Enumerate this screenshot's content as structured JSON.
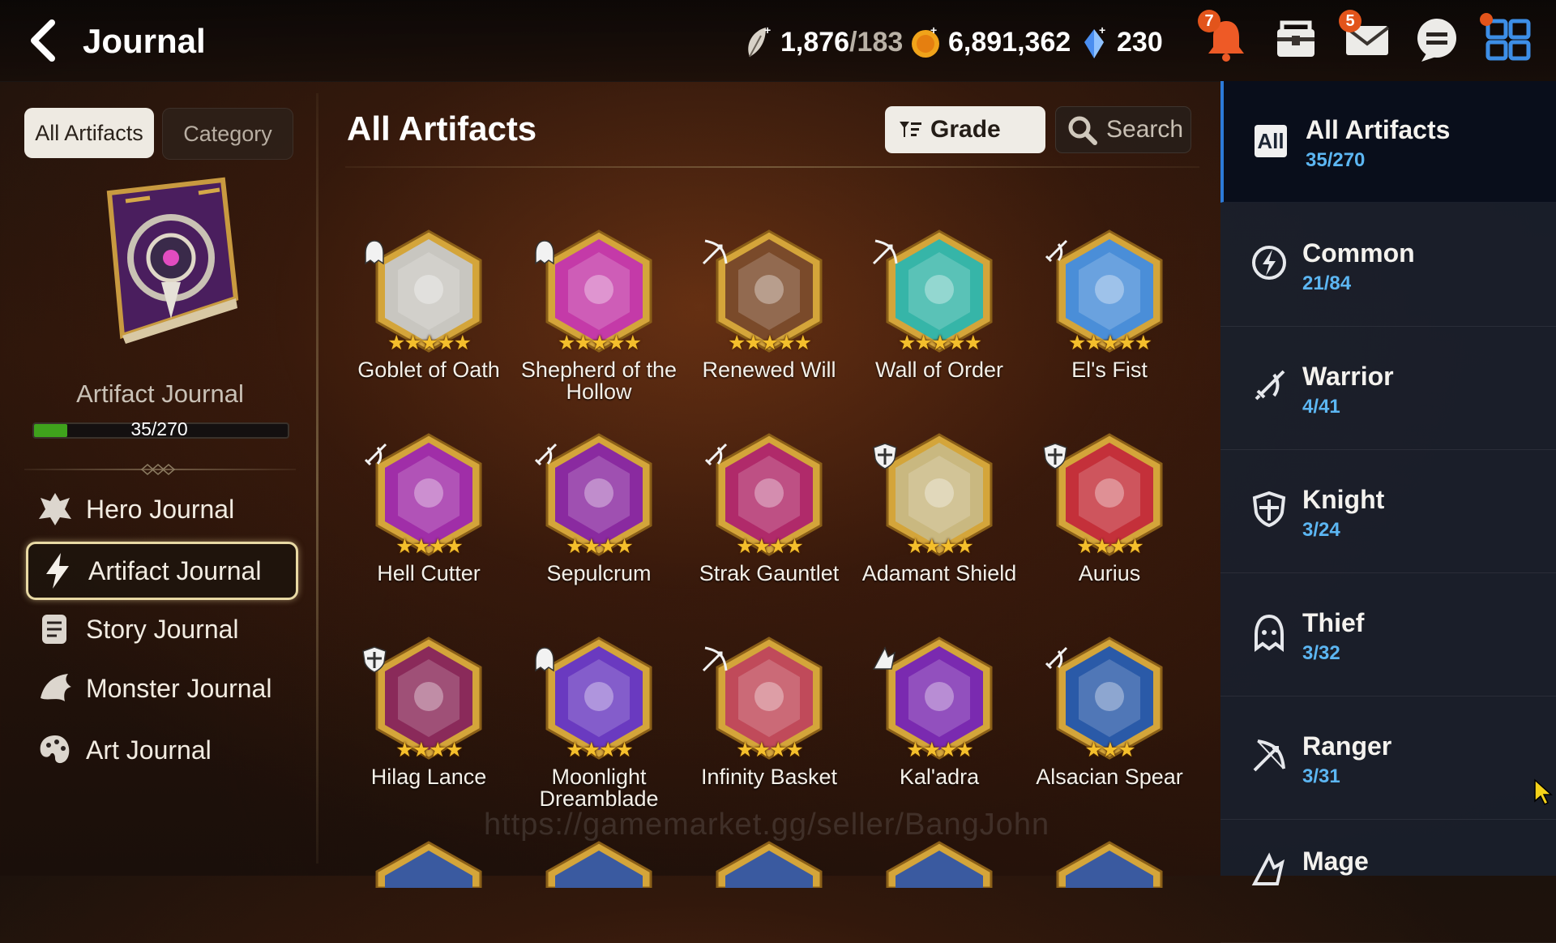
{
  "header": {
    "title": "Journal",
    "resources": [
      {
        "name": "stamina",
        "icon": "leaf-icon",
        "value": "1,876",
        "max": "/183"
      },
      {
        "name": "gold",
        "icon": "gold-coin-icon",
        "value": "6,891,362",
        "max": ""
      },
      {
        "name": "skystone",
        "icon": "crystal-icon",
        "value": "230",
        "max": ""
      }
    ],
    "notifications_badge": "7",
    "mail_badge": "5"
  },
  "left": {
    "tabs": {
      "all": "All Artifacts",
      "category": "Category"
    },
    "journal_label": "Artifact Journal",
    "progress_text": "35/270",
    "progress_fraction": 0.13,
    "nav": [
      {
        "label": "Hero Journal",
        "icon": "hero-icon"
      },
      {
        "label": "Artifact Journal",
        "icon": "lightning-icon"
      },
      {
        "label": "Story Journal",
        "icon": "scroll-icon"
      },
      {
        "label": "Monster Journal",
        "icon": "monster-icon"
      },
      {
        "label": "Art Journal",
        "icon": "palette-icon"
      }
    ]
  },
  "main": {
    "title": "All Artifacts",
    "grade_label": "Grade",
    "search_label": "Search",
    "watermark": "https://gamemarket.gg/seller/BangJohn",
    "artifacts": [
      {
        "name": "Goblet of Oath",
        "stars": "★★★★★",
        "class": "thief",
        "color": "#c8c6c0"
      },
      {
        "name": "Shepherd of the Hollow",
        "stars": "★★★★★",
        "class": "thief",
        "color": "#c43aa8"
      },
      {
        "name": "Renewed Will",
        "stars": "★★★★★",
        "class": "ranger",
        "color": "#7a4a2a"
      },
      {
        "name": "Wall of Order",
        "stars": "★★★★★",
        "class": "ranger",
        "color": "#36b5a8"
      },
      {
        "name": "El's Fist",
        "stars": "★★★★★",
        "class": "warrior",
        "color": "#4a8ed8"
      },
      {
        "name": "Hell Cutter",
        "stars": "★★★★",
        "class": "warrior",
        "color": "#a02ea8"
      },
      {
        "name": "Sepulcrum",
        "stars": "★★★★",
        "class": "warrior",
        "color": "#8a2aa0"
      },
      {
        "name": "Strak Gauntlet",
        "stars": "★★★★",
        "class": "warrior",
        "color": "#b02a6a"
      },
      {
        "name": "Adamant Shield",
        "stars": "★★★★",
        "class": "knight",
        "color": "#c9b880"
      },
      {
        "name": "Aurius",
        "stars": "★★★★",
        "class": "knight",
        "color": "#c4303a"
      },
      {
        "name": "Hilag Lance",
        "stars": "★★★★",
        "class": "knight",
        "color": "#8a2a5a"
      },
      {
        "name": "Moonlight Dreamblade",
        "stars": "★★★★",
        "class": "thief",
        "color": "#6a3ac0"
      },
      {
        "name": "Infinity Basket",
        "stars": "★★★★",
        "class": "ranger",
        "color": "#c04a5a"
      },
      {
        "name": "Kal'adra",
        "stars": "★★★★",
        "class": "mage",
        "color": "#7a2ab0"
      },
      {
        "name": "Alsacian Spear",
        "stars": "★★★",
        "class": "warrior",
        "color": "#2a5aa8"
      }
    ]
  },
  "right": {
    "all_badge": "All",
    "categories": [
      {
        "name": "All Artifacts",
        "count": "35/270",
        "icon": "all-icon"
      },
      {
        "name": "Common",
        "count": "21/84",
        "icon": "common-class-icon"
      },
      {
        "name": "Warrior",
        "count": "4/41",
        "icon": "warrior-class-icon"
      },
      {
        "name": "Knight",
        "count": "3/24",
        "icon": "knight-class-icon"
      },
      {
        "name": "Thief",
        "count": "3/32",
        "icon": "thief-class-icon"
      },
      {
        "name": "Ranger",
        "count": "3/31",
        "icon": "ranger-class-icon"
      },
      {
        "name": "Mage",
        "count": "",
        "icon": "mage-class-icon"
      }
    ]
  }
}
